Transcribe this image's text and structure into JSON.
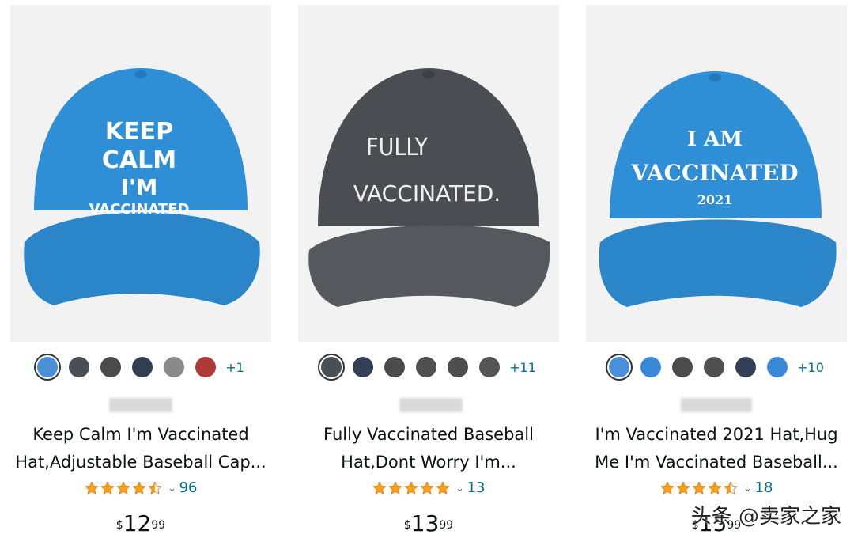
{
  "products": [
    {
      "cap_color": "#2f8fd6",
      "cap_text": [
        "KEEP",
        "CALM",
        "I'M",
        "VACCINATED"
      ],
      "swatches": [
        "#4a90d9",
        "#4a4f55",
        "#4b4b4b",
        "#333f4f",
        "#8a8a8a",
        "#b03a3a"
      ],
      "more_colors": "+1",
      "title_lines": [
        "Keep Calm I'm Vaccinated",
        "Hat,Adjustable Baseball Cap..."
      ],
      "rating": 4.5,
      "rating_count": "96",
      "price_symbol": "$",
      "price_whole": "12",
      "price_cents": "99"
    },
    {
      "cap_color": "#4a4d52",
      "cap_text": [
        "FULLY",
        "VACCINATED."
      ],
      "swatches": [
        "#4a4f55",
        "#333f55",
        "#4b4b4b",
        "#505050",
        "#4e4e4e",
        "#555555"
      ],
      "more_colors": "+11",
      "title_lines": [
        "Fully Vaccinated Baseball",
        "Hat,Dont Worry I'm..."
      ],
      "rating": 5,
      "rating_count": "13",
      "price_symbol": "$",
      "price_whole": "13",
      "price_cents": "99"
    },
    {
      "cap_color": "#2f8fd6",
      "cap_text": [
        "I AM",
        "VACCINATED",
        "2021"
      ],
      "swatches": [
        "#4a90d9",
        "#3a88d8",
        "#4b4b4b",
        "#505050",
        "#333f55",
        "#3a88d8"
      ],
      "more_colors": "+10",
      "title_lines": [
        "I'm Vaccinated 2021 Hat,Hug",
        "Me I'm Vaccinated Baseball..."
      ],
      "rating": 4.5,
      "rating_count": "18",
      "price_symbol": "$",
      "price_whole": "15",
      "price_cents": "99"
    }
  ],
  "watermark": "头条 @卖家之家",
  "colors": {
    "star": "#f7a21b",
    "link": "#007185"
  }
}
